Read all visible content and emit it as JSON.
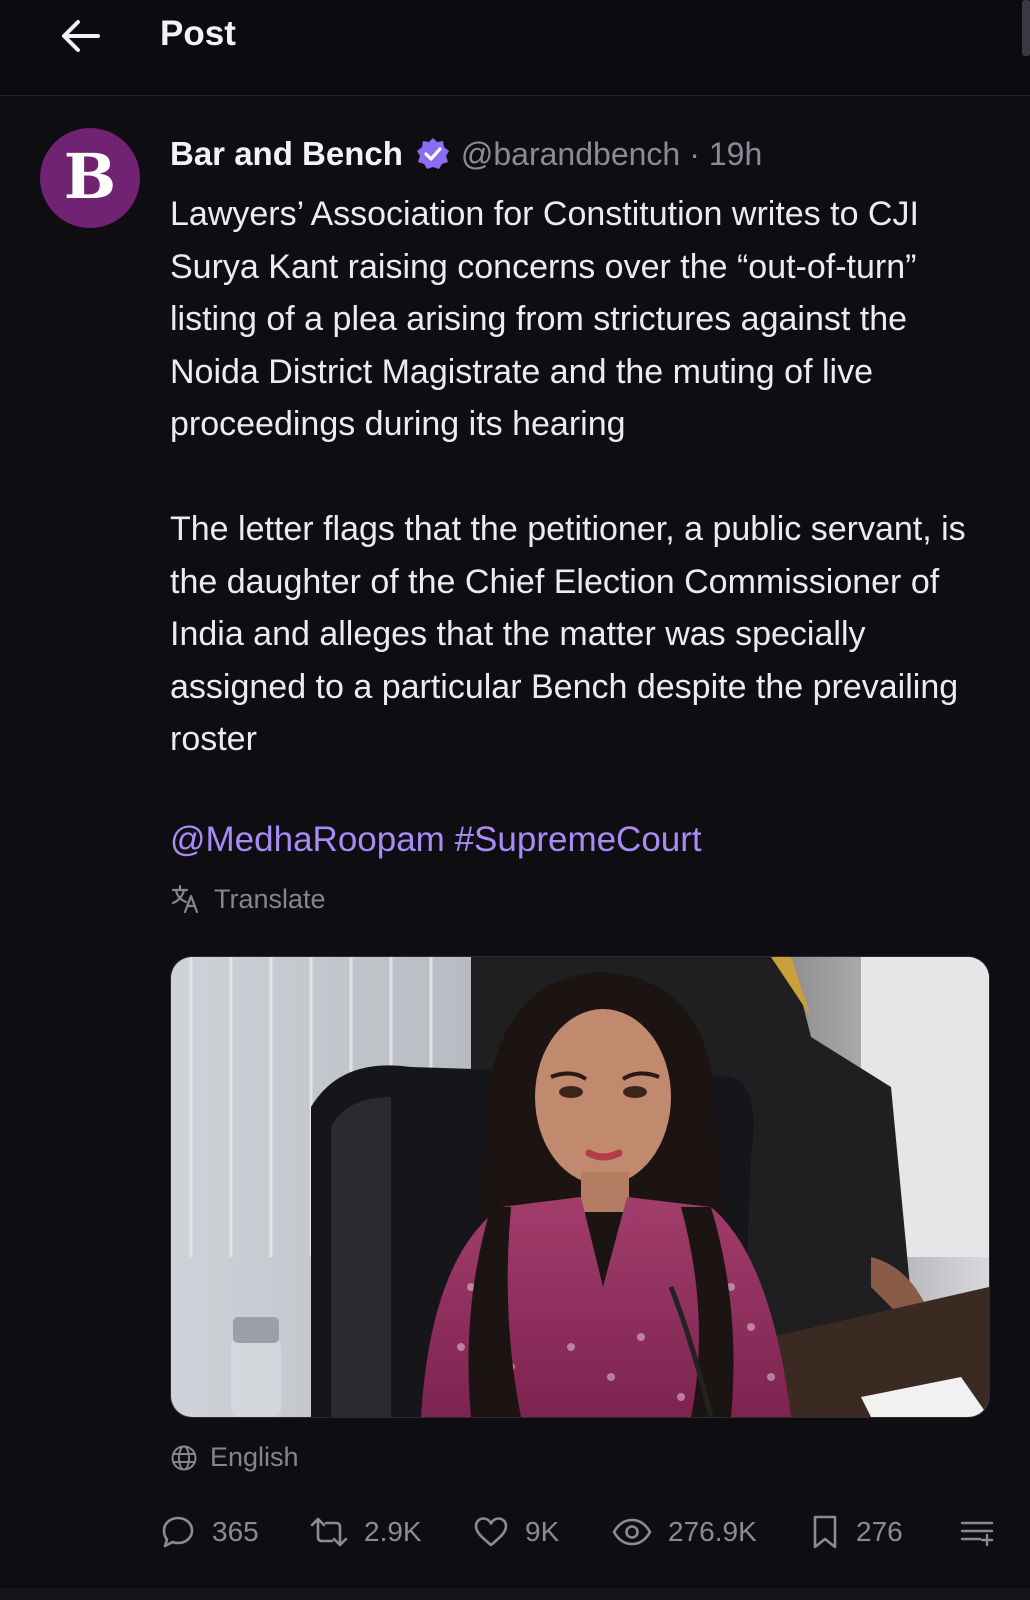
{
  "header": {
    "title": "Post"
  },
  "post": {
    "author": {
      "display_name": "Bar and Bench",
      "handle": "@barandbench",
      "avatar_letter": "B"
    },
    "time_ago": "19h",
    "separator": "·",
    "paragraphs": [
      "Lawyers’ Association for Constitution writes to CJI Surya Kant raising concerns over the “out-of-turn” listing of a plea arising from strictures against the Noida District Magistrate and the muting of live proceedings during its hearing",
      "The letter flags that the petitioner, a public servant, is the daughter of the Chief Election Commissioner of India and alleges that the matter was specially assigned to a particular Bench despite the prevailing roster"
    ],
    "mention": "@MedhaRoopam",
    "hashtag": "#SupremeCourt",
    "translate_label": "Translate",
    "language_label": "English"
  },
  "stats": {
    "replies": "365",
    "reposts": "2.9K",
    "likes": "9K",
    "views": "276.9K",
    "bookmarks": "276"
  },
  "icons": [
    "back-arrow-icon",
    "verified-badge-icon",
    "translate-icon",
    "globe-icon",
    "reply-icon",
    "repost-icon",
    "like-icon",
    "views-icon",
    "bookmark-icon",
    "more-options-icon"
  ],
  "colors": {
    "background": "#0d0d12",
    "link": "#a98bf5",
    "verified": "#8c6cf0",
    "avatar": "#6f2372",
    "muted": "#8b8b97"
  }
}
